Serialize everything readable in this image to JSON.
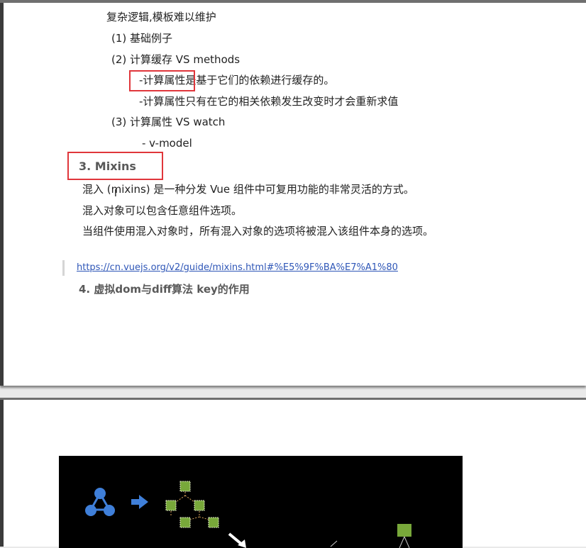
{
  "top_page": {
    "lines": [
      "复杂逻辑,模板难以维护",
      "(1) 基础例子",
      "(2) 计算缓存 VS methods",
      "-计算属性是基于它们的依赖进行缓存的。",
      "-计算属性只有在它的相关依赖发生改变时才会重新求值",
      "(3) 计算属性 VS watch",
      "- v-model"
    ],
    "section3_heading": "3. Mixins",
    "mixins_paragraph": [
      "混入 (mixins) 是一种分发 Vue 组件中可复用功能的非常灵活的方式。",
      "混入对象可以包含任意组件选项。",
      "当组件使用混入对象时，所有混入对象的选项将被混入该组件本身的选项。"
    ],
    "link": "https://cn.vuejs.org/v2/guide/mixins.html#%E5%9F%BA%E7%A1%80",
    "section4_heading": "4. 虚拟dom与diff算法 key的作用"
  },
  "colors": {
    "highlight_box": "#e0363b",
    "heading_gray": "#595959",
    "link_blue": "#2e56b7",
    "diagram_blue": "#3f7fd9",
    "diagram_green": "#78a83a"
  },
  "icons": [
    "text-cursor-icon",
    "arrow-right-icon"
  ]
}
